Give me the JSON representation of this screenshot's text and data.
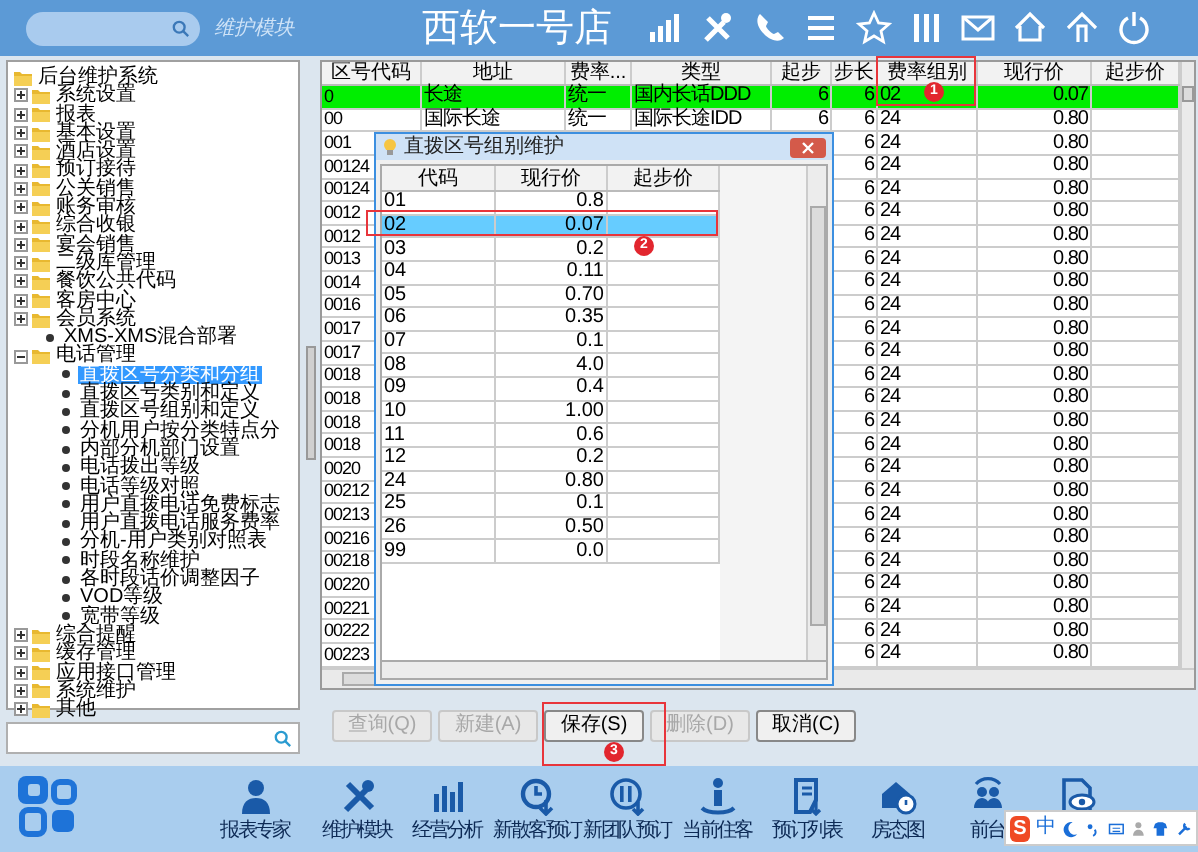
{
  "header": {
    "module_label": "维护模块",
    "title": "西软一号店"
  },
  "tree": {
    "items": [
      {
        "label": "后台维护系统",
        "kind": "folder",
        "expanded": true,
        "selected": false,
        "children": [
          {
            "label": "系统设置",
            "kind": "folder",
            "expanded": false,
            "selected": false
          },
          {
            "label": "报表",
            "kind": "folder",
            "expanded": false,
            "selected": false
          },
          {
            "label": "基本设置",
            "kind": "folder",
            "expanded": false,
            "selected": false
          },
          {
            "label": "酒店设置",
            "kind": "folder",
            "expanded": false,
            "selected": false
          },
          {
            "label": "预订接待",
            "kind": "folder",
            "expanded": false,
            "selected": false
          },
          {
            "label": "公关销售",
            "kind": "folder",
            "expanded": false,
            "selected": false
          },
          {
            "label": "账务审核",
            "kind": "folder",
            "expanded": false,
            "selected": false
          },
          {
            "label": "综合收银",
            "kind": "folder",
            "expanded": false,
            "selected": false
          },
          {
            "label": "宴会销售",
            "kind": "folder",
            "expanded": false,
            "selected": false
          },
          {
            "label": "二级库管理",
            "kind": "folder",
            "expanded": false,
            "selected": false
          },
          {
            "label": "餐饮公共代码",
            "kind": "folder",
            "expanded": false,
            "selected": false
          },
          {
            "label": "客房中心",
            "kind": "folder",
            "expanded": false,
            "selected": false
          },
          {
            "label": "会员系统",
            "kind": "folder",
            "expanded": false,
            "selected": false
          },
          {
            "label": "XMS-XMS混合部署",
            "kind": "leaf",
            "selected": false
          },
          {
            "label": "电话管理",
            "kind": "folder",
            "expanded": true,
            "selected": false,
            "children": [
              {
                "label": "直拨区号分类和分组",
                "kind": "leaf",
                "selected": true
              },
              {
                "label": "直拨区号类别和定义",
                "kind": "leaf",
                "selected": false
              },
              {
                "label": "直拨区号组别和定义",
                "kind": "leaf",
                "selected": false
              },
              {
                "label": "分机用户按分类特点分",
                "kind": "leaf",
                "selected": false
              },
              {
                "label": "内部分机部门设置",
                "kind": "leaf",
                "selected": false
              },
              {
                "label": "电话拨出等级",
                "kind": "leaf",
                "selected": false
              },
              {
                "label": "电话等级对照",
                "kind": "leaf",
                "selected": false
              },
              {
                "label": "用户直拨电话免费标志",
                "kind": "leaf",
                "selected": false
              },
              {
                "label": "用户直拨电话服务费率",
                "kind": "leaf",
                "selected": false
              },
              {
                "label": "分机-用户类别对照表",
                "kind": "leaf",
                "selected": false
              },
              {
                "label": "时段名称维护",
                "kind": "leaf",
                "selected": false
              },
              {
                "label": "各时段话价调整因子",
                "kind": "leaf",
                "selected": false
              },
              {
                "label": "VOD等级",
                "kind": "leaf",
                "selected": false
              },
              {
                "label": "宽带等级",
                "kind": "leaf",
                "selected": false
              }
            ]
          },
          {
            "label": "综合提醒",
            "kind": "folder",
            "expanded": false,
            "selected": false
          },
          {
            "label": "缓存管理",
            "kind": "folder",
            "expanded": false,
            "selected": false
          },
          {
            "label": "应用接口管理",
            "kind": "folder",
            "expanded": false,
            "selected": false
          },
          {
            "label": "系统维护",
            "kind": "folder",
            "expanded": false,
            "selected": false
          },
          {
            "label": "其他",
            "kind": "folder",
            "expanded": false,
            "selected": false
          }
        ]
      }
    ]
  },
  "grid": {
    "columns": [
      "区号代码",
      "地址",
      "费率...",
      "类型",
      "起步",
      "步长",
      "费率组别",
      "现行价",
      "起步价"
    ],
    "rows": [
      {
        "code": "0",
        "address": "长途",
        "rate": "统一",
        "type": "国内长话DDD",
        "start": "6",
        "step": "6",
        "group": "02",
        "price": "0.07",
        "selected": true
      },
      {
        "code": "00",
        "address": "国际长途",
        "rate": "统一",
        "type": "国际长途IDD",
        "start": "6",
        "step": "6",
        "group": "24",
        "price": "0.80",
        "selected": false
      },
      {
        "code": "001",
        "step": "6",
        "group": "24",
        "price": "0.80",
        "selected": false
      },
      {
        "code": "00124",
        "step": "6",
        "group": "24",
        "price": "0.80",
        "selected": false
      },
      {
        "code": "00124",
        "step": "6",
        "group": "24",
        "price": "0.80",
        "selected": false
      },
      {
        "code": "0012",
        "step": "6",
        "group": "24",
        "price": "0.80",
        "selected": false
      },
      {
        "code": "0012",
        "step": "6",
        "group": "24",
        "price": "0.80",
        "selected": false
      },
      {
        "code": "0013",
        "step": "6",
        "group": "24",
        "price": "0.80",
        "selected": false
      },
      {
        "code": "0014",
        "step": "6",
        "group": "24",
        "price": "0.80",
        "selected": false
      },
      {
        "code": "0016",
        "step": "6",
        "group": "24",
        "price": "0.80",
        "selected": false
      },
      {
        "code": "0017",
        "step": "6",
        "group": "24",
        "price": "0.80",
        "selected": false
      },
      {
        "code": "0017",
        "step": "6",
        "group": "24",
        "price": "0.80",
        "selected": false
      },
      {
        "code": "0018",
        "step": "6",
        "group": "24",
        "price": "0.80",
        "selected": false
      },
      {
        "code": "0018",
        "step": "6",
        "group": "24",
        "price": "0.80",
        "selected": false
      },
      {
        "code": "0018",
        "step": "6",
        "group": "24",
        "price": "0.80",
        "selected": false
      },
      {
        "code": "0018",
        "step": "6",
        "group": "24",
        "price": "0.80",
        "selected": false
      },
      {
        "code": "0020",
        "step": "6",
        "group": "24",
        "price": "0.80",
        "selected": false
      },
      {
        "code": "00212",
        "step": "6",
        "group": "24",
        "price": "0.80",
        "selected": false
      },
      {
        "code": "00213",
        "step": "6",
        "group": "24",
        "price": "0.80",
        "selected": false
      },
      {
        "code": "00216",
        "step": "6",
        "group": "24",
        "price": "0.80",
        "selected": false
      },
      {
        "code": "00218",
        "step": "6",
        "group": "24",
        "price": "0.80",
        "selected": false
      },
      {
        "code": "00220",
        "step": "6",
        "group": "24",
        "price": "0.80",
        "selected": false
      },
      {
        "code": "00221",
        "step": "6",
        "group": "24",
        "price": "0.80",
        "selected": false
      },
      {
        "code": "00222",
        "step": "6",
        "group": "24",
        "price": "0.80",
        "selected": false
      },
      {
        "code": "00223",
        "step": "6",
        "group": "24",
        "price": "0.80",
        "selected": false
      }
    ]
  },
  "dialog": {
    "title": "直拨区号组别维护",
    "columns": [
      "代码",
      "现行价",
      "起步价"
    ],
    "rows": [
      {
        "code": "01",
        "price": "0.8",
        "selected": false
      },
      {
        "code": "02",
        "price": "0.07",
        "selected": true
      },
      {
        "code": "03",
        "price": "0.2",
        "selected": false
      },
      {
        "code": "04",
        "price": "0.11",
        "selected": false
      },
      {
        "code": "05",
        "price": "0.70",
        "selected": false
      },
      {
        "code": "06",
        "price": "0.35",
        "selected": false
      },
      {
        "code": "07",
        "price": "0.1",
        "selected": false
      },
      {
        "code": "08",
        "price": "4.0",
        "selected": false
      },
      {
        "code": "09",
        "price": "0.4",
        "selected": false
      },
      {
        "code": "10",
        "price": "1.00",
        "selected": false
      },
      {
        "code": "11",
        "price": "0.6",
        "selected": false
      },
      {
        "code": "12",
        "price": "0.2",
        "selected": false
      },
      {
        "code": "24",
        "price": "0.80",
        "selected": false
      },
      {
        "code": "25",
        "price": "0.1",
        "selected": false
      },
      {
        "code": "26",
        "price": "0.50",
        "selected": false
      },
      {
        "code": "99",
        "price": "0.0",
        "selected": false
      }
    ]
  },
  "buttons": [
    {
      "label": "查询(Q)",
      "disabled": true
    },
    {
      "label": "新建(A)",
      "disabled": true
    },
    {
      "label": "保存(S)",
      "disabled": false
    },
    {
      "label": "删除(D)",
      "disabled": true
    },
    {
      "label": "取消(C)",
      "disabled": false
    }
  ],
  "annotations": [
    {
      "label": "1"
    },
    {
      "label": "2"
    },
    {
      "label": "3"
    }
  ],
  "taskbar": {
    "items": [
      {
        "label": "报表专家"
      },
      {
        "label": "维护模块"
      },
      {
        "label": "经营分析"
      },
      {
        "label": "新散客预订"
      },
      {
        "label": "新团队预订"
      },
      {
        "label": "当前住客"
      },
      {
        "label": "预订列表"
      },
      {
        "label": "房态图"
      },
      {
        "label": "前台"
      }
    ]
  },
  "ime": {
    "logo": "S",
    "mode": "中"
  }
}
